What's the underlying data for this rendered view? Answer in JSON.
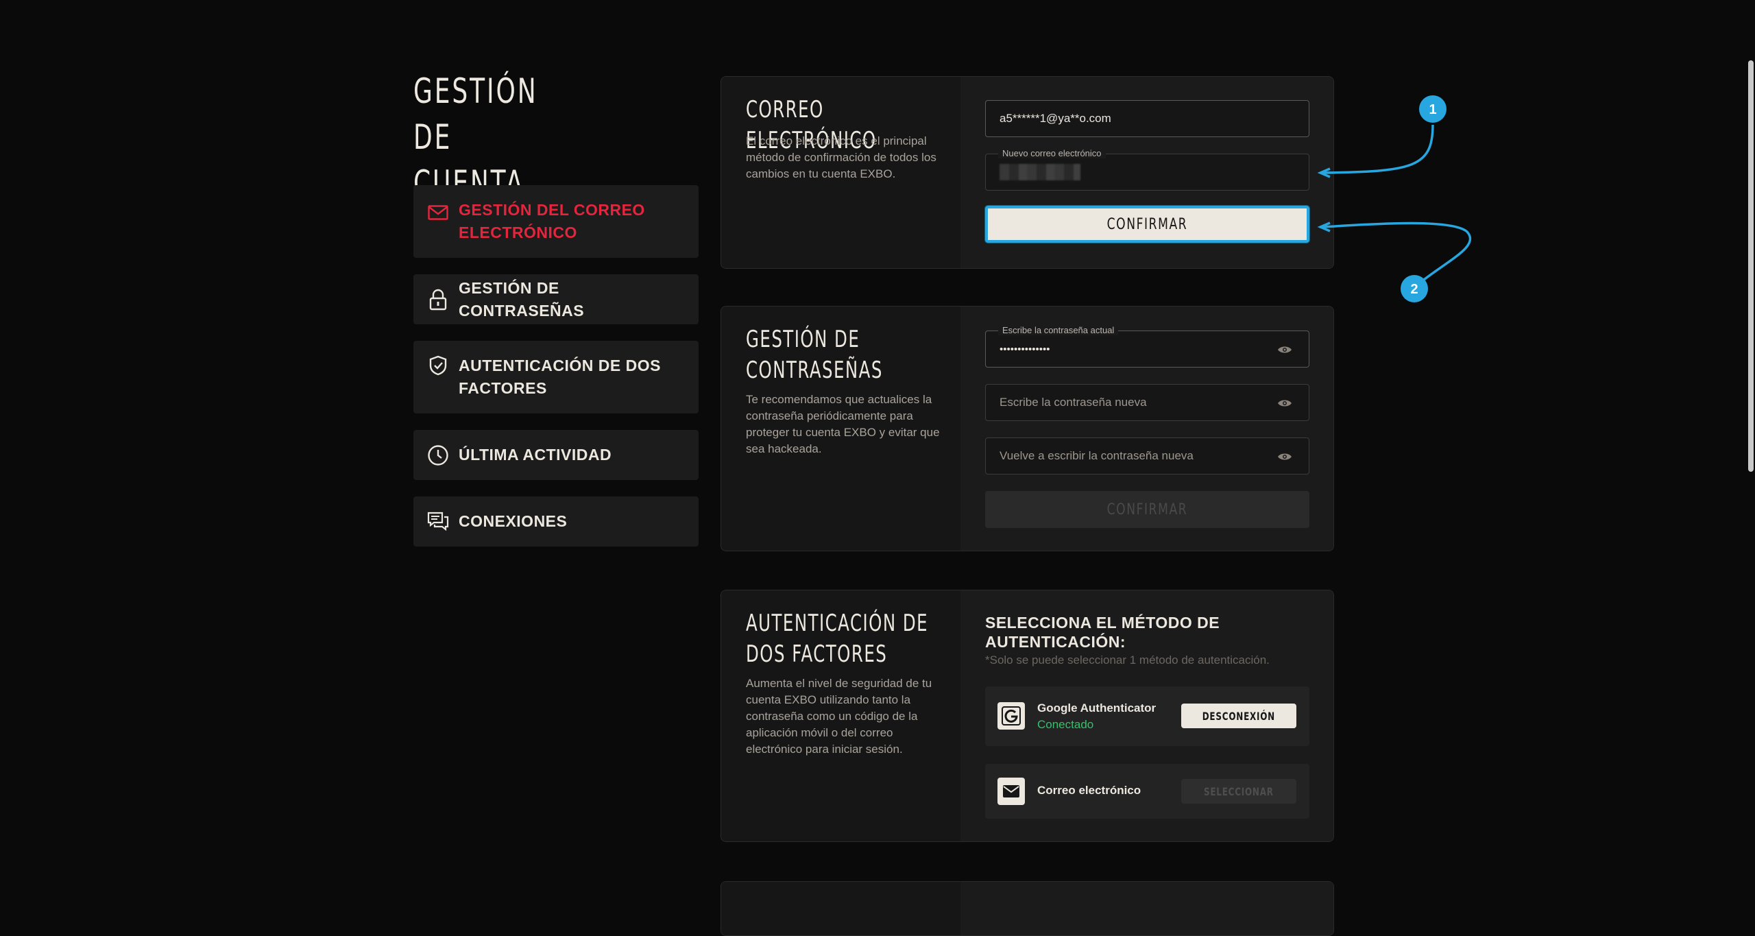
{
  "page_title": "GESTIÓN DE\nCUENTA",
  "nav": [
    {
      "label": "GESTIÓN DEL CORREO ELECTRÓNICO",
      "icon": "mail-icon",
      "active": true
    },
    {
      "label": "GESTIÓN DE CONTRASEÑAS",
      "icon": "lock-icon",
      "active": false
    },
    {
      "label": "AUTENTICACIÓN DE DOS FACTORES",
      "icon": "shield-check-icon",
      "active": false
    },
    {
      "label": "ÚLTIMA ACTIVIDAD",
      "icon": "clock-icon",
      "active": false
    },
    {
      "label": "CONEXIONES",
      "icon": "chat-bubbles-icon",
      "active": false
    }
  ],
  "email_card": {
    "title": "CORREO ELECTRÓNICO",
    "desc": "El correo electrónico es el principal método de confirmación de todos los cambios en tu cuenta EXBO.",
    "current_email": "a5******1@ya**o.com",
    "new_email_label": "Nuevo correo electrónico",
    "confirm_label": "CONFIRMAR"
  },
  "password_card": {
    "title": "GESTIÓN DE\nCONTRASEÑAS",
    "desc": "Te recomendamos que actualices la contraseña periódicamente para proteger tu cuenta EXBO y evitar que sea hackeada.",
    "current_label": "Escribe la contraseña actual",
    "current_value": "••••••••••••••",
    "new_placeholder": "Escribe la contraseña nueva",
    "repeat_placeholder": "Vuelve a escribir la contraseña nueva",
    "confirm_label": "CONFIRMAR"
  },
  "tfa_card": {
    "title": "AUTENTICACIÓN DE\nDOS FACTORES",
    "desc": "Aumenta el nivel de seguridad de tu cuenta EXBO utilizando tanto la contraseña como un código de la aplicación móvil o del correo electrónico para iniciar sesión.",
    "select_title": "SELECCIONA EL MÉTODO DE AUTENTICACIÓN:",
    "note": "*Solo se puede seleccionar 1 método de autenticación.",
    "methods": [
      {
        "name": "Google Authenticator",
        "status": "Conectado",
        "action": "DESCONEXIÓN",
        "icon": "google-icon"
      },
      {
        "name": "Correo electrónico",
        "status": "",
        "action": "SELECCIONAR",
        "icon": "envelope-icon"
      }
    ]
  },
  "annotations": [
    "1",
    "2"
  ],
  "colors": {
    "accent": "#e3263d",
    "annotation": "#27a6e0",
    "connected": "#33c26a",
    "background": "#0a0a0a"
  }
}
